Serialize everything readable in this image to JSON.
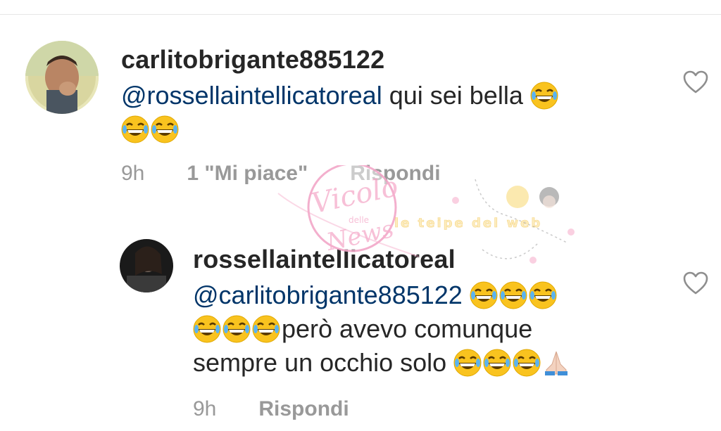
{
  "comments": [
    {
      "username": "carlitobrigante885122",
      "mention": "@rossellaintellicatoreal",
      "text_line1": " qui sei bella ",
      "time": "9h",
      "likes": "1 \"Mi piace\"",
      "reply": "Rispondi",
      "icon": "heart-outline-icon"
    },
    {
      "username": "rossellaintellicatoreal",
      "mention": "@carlitobrigante885122",
      "text_line2": "però avevo comunque",
      "text_line3": "sempre un occhio solo ",
      "time": "9h",
      "reply": "Rispondi",
      "icon": "heart-outline-icon"
    }
  ],
  "watermark": {
    "title": "Vicolo",
    "small": "delle",
    "title2": "News",
    "tagline": "le teipe del web"
  },
  "colors": {
    "mention": "#003569",
    "meta": "#999999",
    "text": "#262626",
    "emoji": "#f9c31f"
  }
}
